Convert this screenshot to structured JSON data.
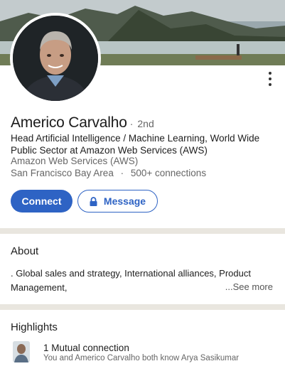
{
  "profile": {
    "name": "Americo Carvalho",
    "separator": "·",
    "degree": "2nd",
    "headline": "Head Artificial Intelligence / Machine Learning, World Wide Public Sector at Amazon Web Services (AWS)",
    "company": "Amazon Web Services (AWS)",
    "location": "San Francisco Bay Area",
    "dot": "·",
    "connections": "500+ connections"
  },
  "actions": {
    "connect_label": "Connect",
    "message_label": "Message"
  },
  "about": {
    "title": "About",
    "text": ". Global sales and strategy, International alliances, Product Management,",
    "see_more_label": "...See more"
  },
  "highlights": {
    "title": "Highlights",
    "mutual_title": "1 Mutual connection",
    "mutual_subtitle": "You and Americo Carvalho both know Arya Sasikumar"
  },
  "icons": {
    "more": "more-vertical-icon",
    "lock": "lock-icon"
  },
  "colors": {
    "accent": "#2e63c4",
    "divider": "#e9e6df",
    "secondary_text": "#666666"
  }
}
